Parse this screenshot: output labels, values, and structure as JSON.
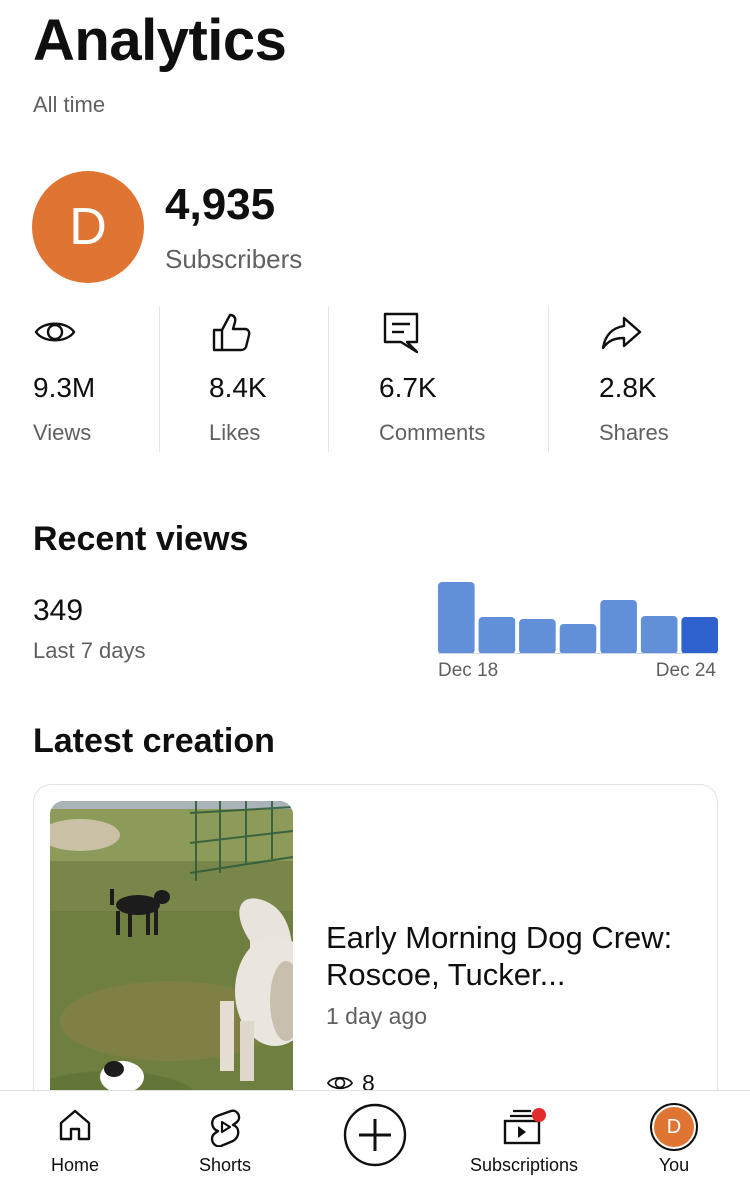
{
  "header": {
    "title": "Analytics",
    "subtitle": "All time"
  },
  "channel": {
    "avatar_letter": "D",
    "avatar_color": "#e07533",
    "subscribers_value": "4,935",
    "subscribers_label": "Subscribers"
  },
  "stats": [
    {
      "icon": "eye-icon",
      "value": "9.3M",
      "label": "Views"
    },
    {
      "icon": "thumbs-up-icon",
      "value": "8.4K",
      "label": "Likes"
    },
    {
      "icon": "comment-icon",
      "value": "6.7K",
      "label": "Comments"
    },
    {
      "icon": "share-icon",
      "value": "2.8K",
      "label": "Shares"
    }
  ],
  "recent_views": {
    "title": "Recent views",
    "value": "349",
    "label": "Last 7 days",
    "start_label": "Dec 18",
    "end_label": "Dec 24"
  },
  "chart_data": {
    "type": "bar",
    "categories": [
      "Dec 18",
      "Dec 19",
      "Dec 20",
      "Dec 21",
      "Dec 22",
      "Dec 23",
      "Dec 24"
    ],
    "values": [
      72,
      37,
      35,
      30,
      54,
      38,
      37
    ],
    "colors": {
      "bar": "#6190d8",
      "highlight": "#2f62cf"
    },
    "title": "",
    "xlabel": "",
    "ylabel": ""
  },
  "latest": {
    "title": "Latest creation",
    "video_title": "Early Morning Dog Crew: Roscoe, Tucker...",
    "age": "1 day ago",
    "views": "8"
  },
  "nav": [
    {
      "icon": "home-icon",
      "label": "Home"
    },
    {
      "icon": "shorts-icon",
      "label": "Shorts"
    },
    {
      "icon": "create-icon",
      "label": ""
    },
    {
      "icon": "subscriptions-icon",
      "label": "Subscriptions"
    },
    {
      "icon": "avatar",
      "label": "You",
      "letter": "D"
    }
  ]
}
